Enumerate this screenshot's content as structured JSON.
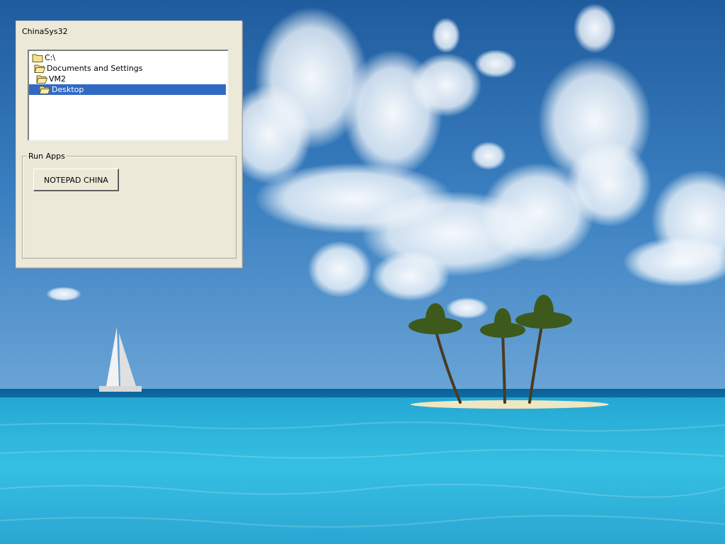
{
  "window": {
    "title": "ChinaSys32"
  },
  "tree": {
    "items": [
      {
        "label": "C:\\",
        "icon": "folder-icon",
        "selected": false
      },
      {
        "label": "Documents and Settings",
        "icon": "folder-open-icon",
        "selected": false
      },
      {
        "label": "VM2",
        "icon": "folder-open-icon",
        "selected": false
      },
      {
        "label": "Desktop",
        "icon": "folder-open-icon",
        "selected": true
      }
    ]
  },
  "run_apps": {
    "label": "Run Apps",
    "notepad_button": "NOTEPAD CHINA"
  },
  "colors": {
    "selection": "#316ac5",
    "window_bg": "#ece9d8",
    "sky": "#2f6fb0",
    "sea": "#2fb4d6"
  }
}
